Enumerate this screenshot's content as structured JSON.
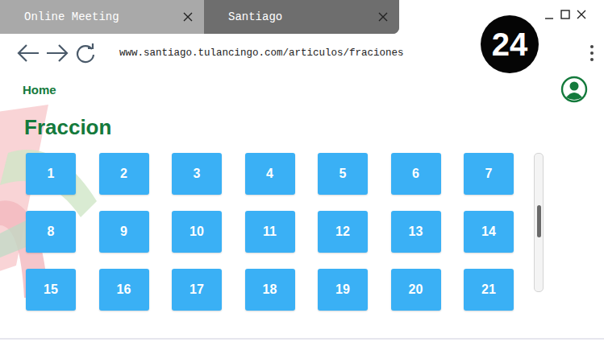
{
  "tabs": [
    {
      "label": "Online Meeting",
      "selected": false
    },
    {
      "label": "Santiago",
      "selected": true
    }
  ],
  "address": {
    "url": "www.santiago.tulancingo.com/articulos/fraciones"
  },
  "badge": "24",
  "nav": {
    "home": "Home"
  },
  "page": {
    "title": "Fraccion"
  },
  "buttons": [
    "1",
    "2",
    "3",
    "4",
    "5",
    "6",
    "7",
    "8",
    "9",
    "10",
    "11",
    "12",
    "13",
    "14",
    "15",
    "16",
    "17",
    "18",
    "19",
    "20",
    "21"
  ],
  "scrollbar": {
    "position": 0.49
  }
}
